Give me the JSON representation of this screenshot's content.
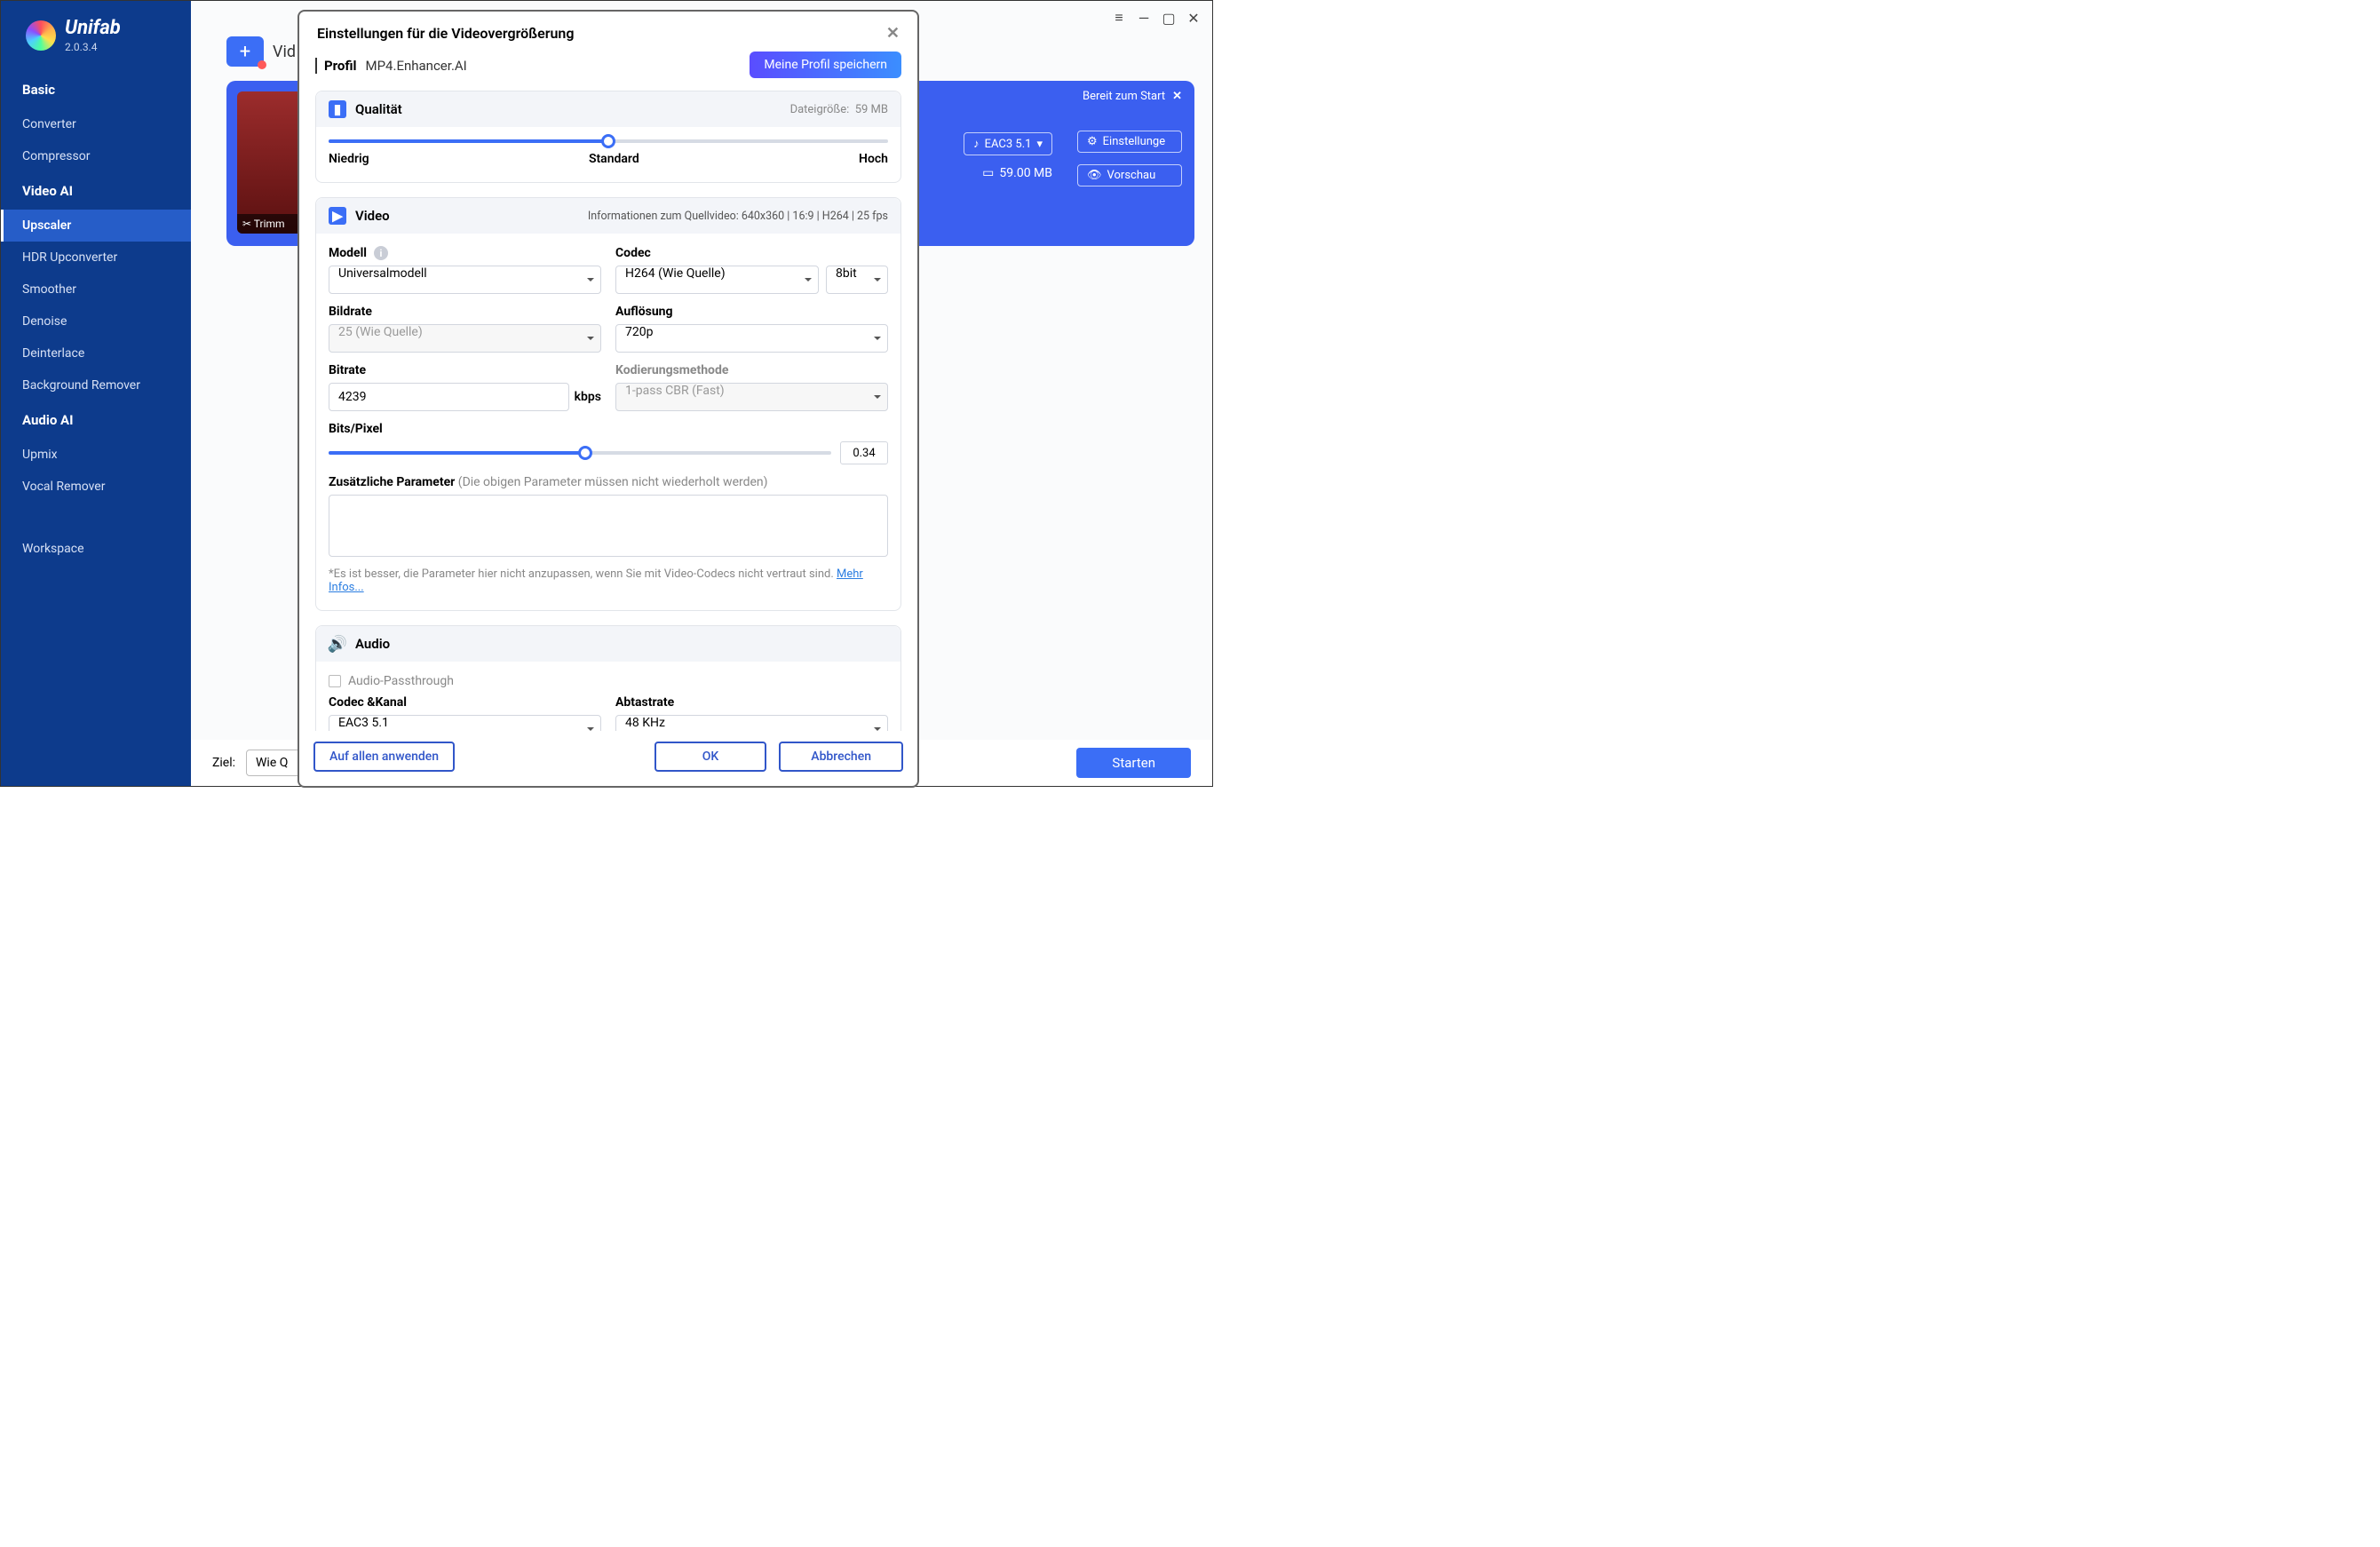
{
  "app": {
    "name": "Unifab",
    "version": "2.0.3.4"
  },
  "sidebar": {
    "basic": "Basic",
    "basic_items": [
      "Converter",
      "Compressor"
    ],
    "video_ai": "Video AI",
    "video_items": [
      "Upscaler",
      "HDR Upconverter",
      "Smoother",
      "Denoise",
      "Deinterlace",
      "Background Remover"
    ],
    "audio_ai": "Audio AI",
    "audio_items": [
      "Upmix",
      "Vocal Remover"
    ],
    "workspace": "Workspace"
  },
  "main": {
    "vid_label": "Vid",
    "ziel_label": "Ziel:",
    "ziel_value": "Wie Q",
    "start": "Starten"
  },
  "card": {
    "trim": "Trimm",
    "status": "Bereit zum Start",
    "audio_chip": "EAC3 5.1",
    "size": "59.00 MB",
    "settings": "Einstellunge",
    "preview": "Vorschau"
  },
  "modal": {
    "title": "Einstellungen für die Videovergrößerung",
    "profile_label": "Profil",
    "profile_name": "MP4.Enhancer.AI",
    "save_profile": "Meine Profil speichern",
    "quality_section": "Qualität",
    "file_size_label": "Dateigröße:",
    "file_size_value": "59 MB",
    "q_low": "Niedrig",
    "q_std": "Standard",
    "q_high": "Hoch",
    "video_section": "Video",
    "video_info": "Informationen zum Quellvideo: 640x360 | 16:9 | H264 | 25 fps",
    "modell_label": "Modell",
    "modell_value": "Universalmodell",
    "codec_label": "Codec",
    "codec_value": "H264 (Wie Quelle)",
    "bit_depth": "8bit",
    "bildrate_label": "Bildrate",
    "bildrate_value": "25 (Wie Quelle)",
    "aufloesung_label": "Auflösung",
    "aufloesung_value": "720p",
    "bitrate_label": "Bitrate",
    "bitrate_value": "4239",
    "kbps": "kbps",
    "kod_label": "Kodierungsmethode",
    "kod_value": "1-pass CBR (Fast)",
    "bitspixel_label": "Bits/Pixel",
    "bitspixel_value": "0.34",
    "extra_label": "Zusätzliche Parameter",
    "extra_hint": "(Die obigen Parameter müssen nicht wiederholt werden)",
    "footnote": "*Es ist besser, die Parameter hier nicht anzupassen, wenn Sie mit Video-Codecs nicht vertraut sind.",
    "more_info": "Mehr Infos...",
    "audio_section": "Audio",
    "audio_passthrough": "Audio-Passthrough",
    "codec_kanal": "Codec &Kanal",
    "codec_kanal_value": "EAC3 5.1",
    "abtast_label": "Abtastrate",
    "abtast_value": "48 KHz",
    "apply_all": "Auf allen anwenden",
    "ok": "OK",
    "cancel": "Abbrechen"
  }
}
